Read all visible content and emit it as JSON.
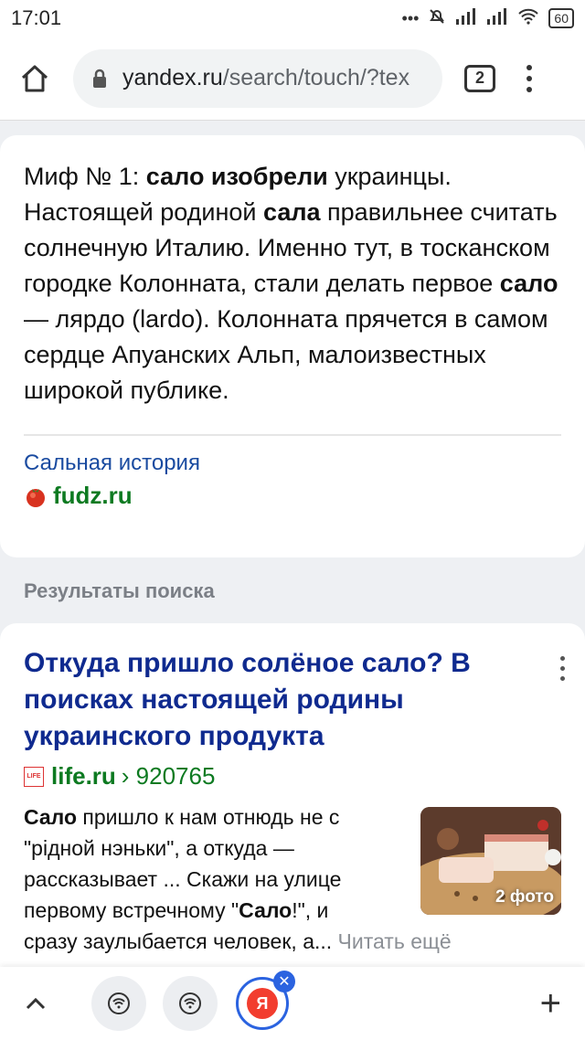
{
  "status_bar": {
    "time": "17:01",
    "battery": "60",
    "icons": [
      "more-dots-icon",
      "mute-icon",
      "signal-icon",
      "signal-icon",
      "wifi-icon",
      "battery-icon"
    ]
  },
  "browser": {
    "url_host": "yandex.ru",
    "url_path": "/search/touch/?tex",
    "tab_count": "2"
  },
  "fact_card": {
    "p1": "Миф № 1: ",
    "b1": "сало изобрели",
    "p2": " украинцы. Настоящей родиной ",
    "b2": "сала",
    "p3": " правильнее считать солнечную Италию. Именно тут, в тосканском городке Колонната, стали делать первое ",
    "b3": "сало",
    "p4": " — ляpдо (lardo). Колонната прячется в самом сердце Апуанских Альп, малоизвестных широкой публике.",
    "source_title": "Сальная история",
    "source_domain": "fudz.ru"
  },
  "section_label": "Результаты поиска",
  "result": {
    "title_a": "Откуда пришло солёное ",
    "title_b": "сало",
    "title_c": "? В поисках настоящей родины украинского продукта",
    "favicon_text": "LIFE",
    "domain": "life.ru",
    "crumb": "› 920765",
    "s_b1": "Сало",
    "s_1": " пришло к нам отнюдь не с \"рідной нэньки\", а откуда — рассказывает ... Скажи на улице первому встречному \"",
    "s_b2": "Сало",
    "s_2": "!\", и",
    "s_3": "сразу заулыбается человек, а... ",
    "read_more": "Читать ещё",
    "photo_badge": "2 фото"
  },
  "bottom_nav": {
    "ya_letter": "Я",
    "close_glyph": "✕",
    "plus_glyph": "+"
  }
}
